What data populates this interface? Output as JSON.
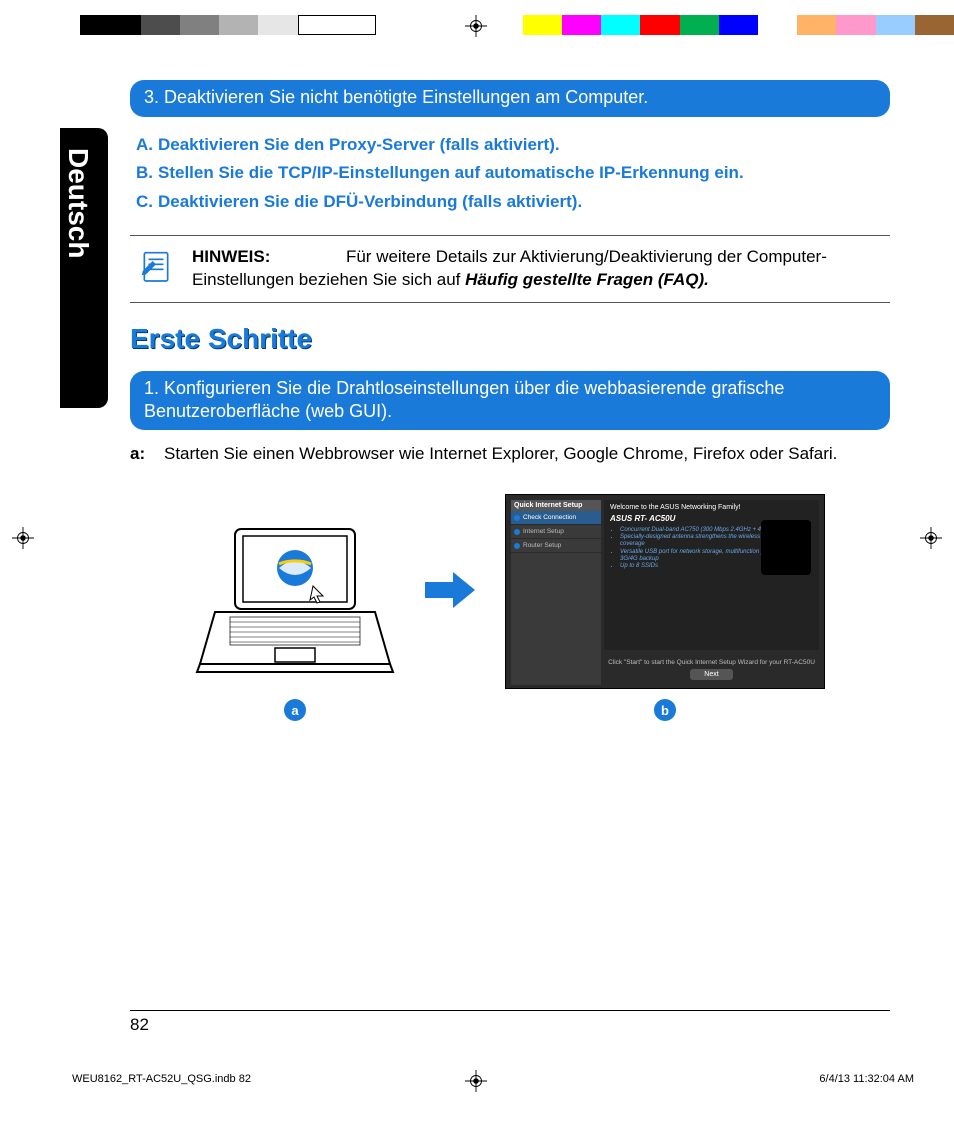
{
  "lang_tab": "Deutsch",
  "pill_3": "3.  Deaktivieren Sie nicht benötigte Einstellungen am Computer.",
  "abc": {
    "a": {
      "lbl": "A.",
      "txt": "Deaktivieren Sie den Proxy-Server (falls aktiviert)."
    },
    "b": {
      "lbl": "B.",
      "txt": "Stellen Sie die TCP/IP-Einstellungen auf automatische IP-Erkennung ein."
    },
    "c": {
      "lbl": "C.",
      "txt": "Deaktivieren Sie die DFÜ-Verbindung (falls aktiviert)."
    }
  },
  "note": {
    "label": "HINWEIS:",
    "text_before": "Für weitere Details zur Aktivierung/Deaktivierung der Computer-Einstellungen beziehen Sie sich auf ",
    "faq": "Häufig gestellte Fragen (FAQ).",
    "text_after": ""
  },
  "section_title": "Erste Schritte",
  "pill_1": "1.  Konfigurieren Sie die Drahtloseinstellungen über die webbasierende grafische Benutzeroberfläche (web GUI).",
  "step_a": {
    "lbl": "a:",
    "txt": "Starten Sie einen Webbrowser wie Internet Explorer, Google Chrome, Firefox oder Safari."
  },
  "illus": {
    "a_label": "a",
    "b_label": "b"
  },
  "router_panel": {
    "side_header": "Quick Internet Setup",
    "side_items": [
      "Check Connection",
      "Internet Setup",
      "Router Setup"
    ],
    "welcome": "Welcome to the ASUS Networking Family!",
    "model": "ASUS RT- AC50U",
    "bullets": [
      "Concurrent Dual-band AC750 (300 Mbps 2.4GHz + 433 Mbps 5GHz)",
      "Specially-designed antenna strengthens the wireless signal up to 150% coverage",
      "Versatile USB port for network storage, multifunction printer server or 3G/4G backup",
      "Up to 8 SSIDs"
    ],
    "footer_line": "Click \"Start\" to start the Quick Internet Setup Wizard for your RT-AC50U",
    "button": "Next"
  },
  "page_number": "82",
  "footer_slug": "WEU8162_RT-AC52U_QSG.indb   82",
  "footer_date": "6/4/13   11:32:04 AM"
}
